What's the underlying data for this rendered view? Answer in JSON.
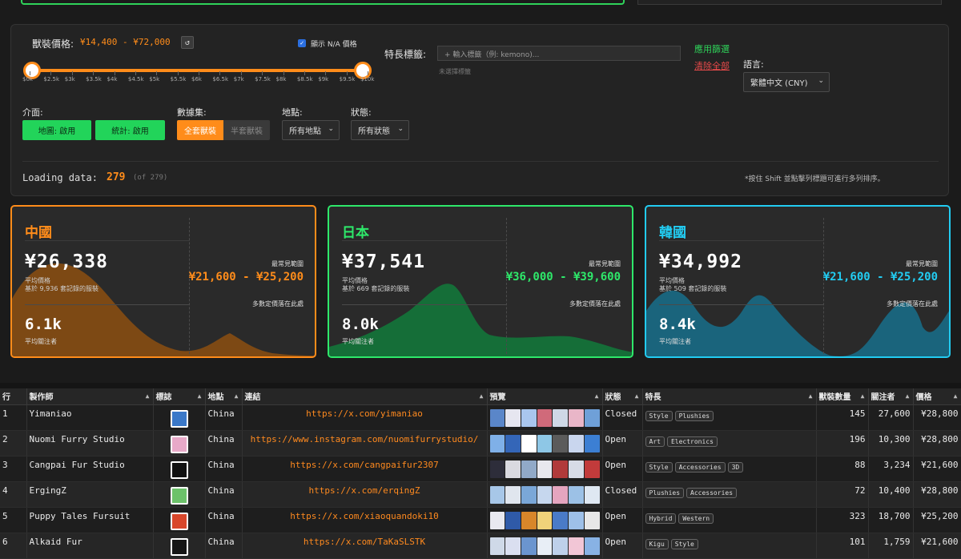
{
  "filters": {
    "price_label": "獸裝價格:",
    "price_range": "¥14,400 - ¥72,000",
    "reset_icon": "↺",
    "show_na_label": "顯示 N/A 價格",
    "show_na_checked": true,
    "ticks": [
      "$0k",
      "$2.5k",
      "$3k",
      "$3.5k",
      "$4k",
      "$4.5k",
      "$5k",
      "$5.5k",
      "$6k",
      "$6.5k",
      "$7k",
      "$7.5k",
      "$8k",
      "$8.5k",
      "$9k",
      "$9.5k",
      "$10k"
    ],
    "tags_label": "特長標籤:",
    "tags_placeholder": "+ 輸入標籤（例: kemono)...",
    "tags_none": "未選擇標籤",
    "apply_label": "應用篩選",
    "clear_label": "清除全部",
    "language_label": "語言:",
    "language_value": "繁體中文 (CNY)",
    "interface_label": "介面:",
    "map_toggle": "地圖: 啟用",
    "stats_toggle": "統計: 啟用",
    "dataset_label": "數據集:",
    "dataset_full": "全套獸裝",
    "dataset_half": "半套獸裝",
    "location_label": "地點:",
    "location_value": "所有地點",
    "status_label": "狀態:",
    "status_value": "所有狀態",
    "loading_label": "Loading data:",
    "loading_count": "279",
    "loading_total": "(of 279)",
    "shift_hint": "*按住 Shift 並點擊列標題可進行多列排序。"
  },
  "cards": [
    {
      "title": "中國",
      "avg": "¥26,338",
      "avg_label": "平均價格",
      "based_on": "基於 9,936 套記錄的服裝",
      "range_label": "最常見範圍",
      "range": "¥21,600 - ¥25,200",
      "range_note": "多數定價落在此處",
      "followers": "6.1k",
      "followers_label": "平均關注者",
      "color": "#ff8c1a"
    },
    {
      "title": "日本",
      "avg": "¥37,541",
      "avg_label": "平均價格",
      "based_on": "基於 669 套記錄的服裝",
      "range_label": "最常見範圍",
      "range": "¥36,000 - ¥39,600",
      "range_note": "多數定價落在此處",
      "followers": "8.0k",
      "followers_label": "平均關注者",
      "color": "#2ee86a"
    },
    {
      "title": "韓國",
      "avg": "¥34,992",
      "avg_label": "平均價格",
      "based_on": "基於 509 套記錄的服裝",
      "range_label": "最常見範圍",
      "range": "¥21,600 - ¥25,200",
      "range_note": "多數定價落在此處",
      "followers": "8.4k",
      "followers_label": "平均關注者",
      "color": "#22ccf2"
    }
  ],
  "table": {
    "headers": [
      "行",
      "製作師",
      "標誌",
      "地點",
      "連結",
      "預覽",
      "狀態",
      "特長",
      "獸裝數量",
      "關注者",
      "價格"
    ],
    "rows": [
      {
        "row": "1",
        "maker": "Yimaniao",
        "location": "China",
        "link": "https://x.com/yimaniao",
        "status": "Closed",
        "tags": [
          "Style",
          "Plushies"
        ],
        "count": "145",
        "followers": "27,600",
        "price": "¥28,800",
        "logo_color": "#3a78c8"
      },
      {
        "row": "2",
        "maker": "Nuomi Furry Studio",
        "location": "China",
        "link": "https://www.instagram.com/nuomifurrystudio/",
        "status": "Open",
        "tags": [
          "Art",
          "Electronics"
        ],
        "count": "196",
        "followers": "10,300",
        "price": "¥28,800",
        "logo_color": "#e8a9c8"
      },
      {
        "row": "3",
        "maker": "Cangpai Fur Studio",
        "location": "China",
        "link": "https://x.com/cangpaifur2307",
        "status": "Open",
        "tags": [
          "Style",
          "Accessories",
          "3D"
        ],
        "count": "88",
        "followers": "3,234",
        "price": "¥21,600",
        "logo_color": "#111111"
      },
      {
        "row": "4",
        "maker": "ErgingZ",
        "location": "China",
        "link": "https://x.com/erqingZ",
        "status": "Closed",
        "tags": [
          "Plushies",
          "Accessories"
        ],
        "count": "72",
        "followers": "10,400",
        "price": "¥28,800",
        "logo_color": "#6cc26a"
      },
      {
        "row": "5",
        "maker": "Puppy Tales Fursuit",
        "location": "China",
        "link": "https://x.com/xiaoquandoki10",
        "status": "Open",
        "tags": [
          "Hybrid",
          "Western"
        ],
        "count": "323",
        "followers": "18,700",
        "price": "¥25,200",
        "logo_color": "#d9472b"
      },
      {
        "row": "6",
        "maker": "Alkaid Fur",
        "location": "China",
        "link": "https://x.com/TaKaSLSTK",
        "status": "Open",
        "tags": [
          "Kigu",
          "Style"
        ],
        "count": "101",
        "followers": "1,759",
        "price": "¥21,600",
        "logo_color": "#151515"
      }
    ]
  }
}
